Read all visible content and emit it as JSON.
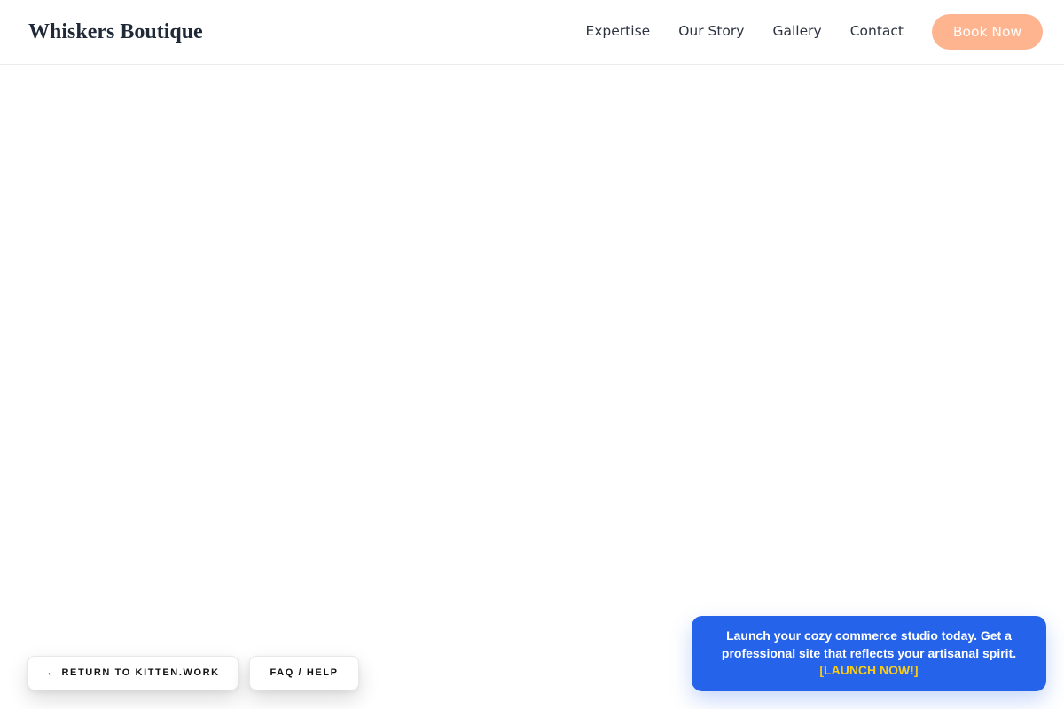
{
  "header": {
    "brand": "Whiskers Boutique",
    "nav": [
      {
        "label": "Expertise"
      },
      {
        "label": "Our Story"
      },
      {
        "label": "Gallery"
      },
      {
        "label": "Contact"
      }
    ],
    "cta_label": "Book Now"
  },
  "floating": {
    "return_label": "← RETURN TO KITTEN.WORK",
    "faq_label": "FAQ / HELP"
  },
  "promo": {
    "text": "Launch your cozy commerce studio today. Get a professional site that reflects your artisanal spirit.",
    "cta_label": "[LAUNCH NOW!]"
  },
  "colors": {
    "accent": "#fdb48f",
    "promo_bg": "#2563eb",
    "promo_cta": "#facc15",
    "text": "#1f2937"
  }
}
